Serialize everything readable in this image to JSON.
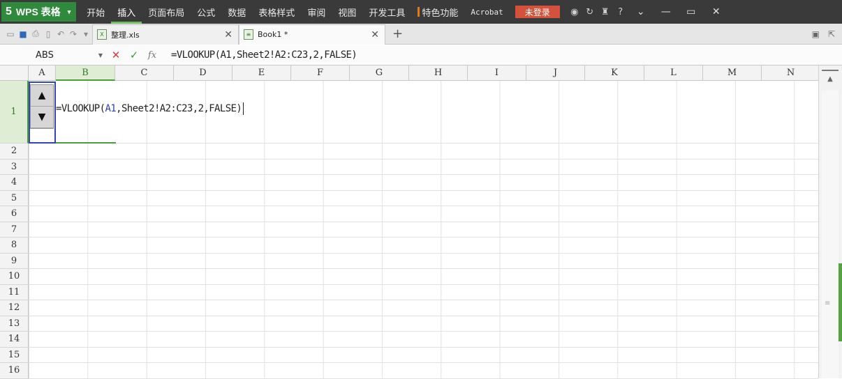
{
  "app": {
    "logo_mark": "5",
    "name": "WPS 表格",
    "dropdown_caret": "▾"
  },
  "menu": [
    {
      "label": "开始"
    },
    {
      "label": "插入",
      "active": true
    },
    {
      "label": "页面布局"
    },
    {
      "label": "公式"
    },
    {
      "label": "数据"
    },
    {
      "label": "表格样式"
    },
    {
      "label": "审阅"
    },
    {
      "label": "视图"
    },
    {
      "label": "开发工具"
    },
    {
      "label": "特色功能"
    },
    {
      "label": "Acrobat"
    }
  ],
  "login_label": "未登录",
  "title_icons": [
    "skin-icon",
    "sync-icon",
    "shirt-icon",
    "help-icon"
  ],
  "help_label": "?",
  "window_controls": {
    "collapse": "⌄",
    "minimize": "—",
    "restore": "▭",
    "close": "✕"
  },
  "tabs": [
    {
      "label": "整理.xls",
      "close": "✕"
    },
    {
      "label": "Book1 *",
      "close": "✕"
    }
  ],
  "new_tab": "+",
  "formula_bar": {
    "name_box": "ABS",
    "cancel": "✕",
    "enter": "✓",
    "fx": "fx",
    "formula": "=VLOOKUP(A1,Sheet2!A2:C23,2,FALSE)"
  },
  "columns": [
    "A",
    "B",
    "C",
    "D",
    "E",
    "F",
    "G",
    "H",
    "I",
    "J",
    "K",
    "L",
    "M",
    "N"
  ],
  "rows": [
    "1",
    "2",
    "3",
    "4",
    "5",
    "6",
    "7",
    "8",
    "9",
    "10",
    "11",
    "12",
    "13",
    "14",
    "15",
    "16"
  ],
  "cell_editor": {
    "prefix": "=VLOOKUP(",
    "ref": "A1",
    "suffix": ",Sheet2!A2:C23,2,FALSE)"
  },
  "spin": {
    "up": "▲",
    "down": "▼"
  },
  "colors": {
    "accent": "#4a9d3c",
    "brand": "#2f8a3c",
    "login": "#d4523b",
    "ref_blue": "#3444b8"
  }
}
